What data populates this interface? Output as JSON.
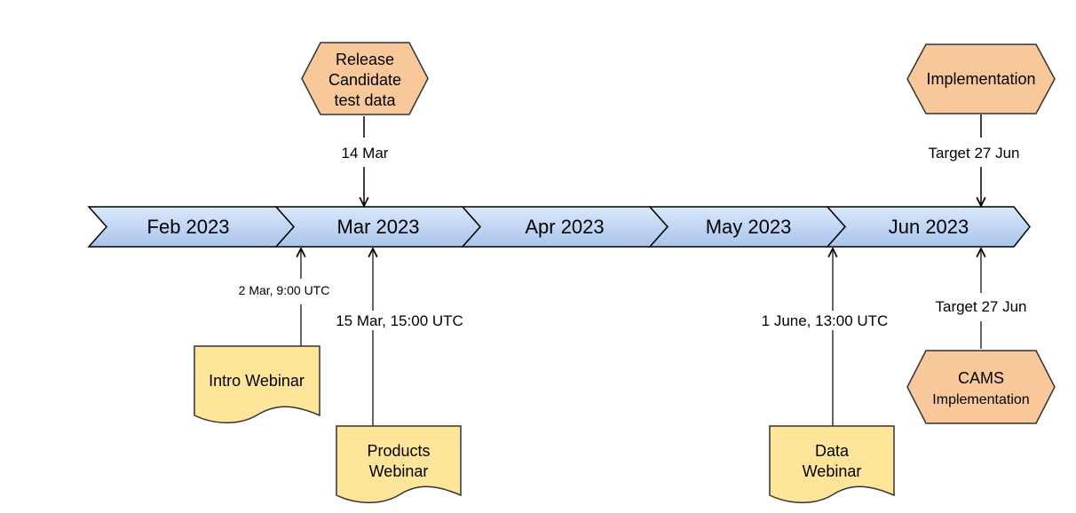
{
  "months": [
    "Feb 2023",
    "Mar 2023",
    "Apr 2023",
    "May 2023",
    "Jun 2023"
  ],
  "milestones_above": [
    {
      "lines": [
        "Release",
        "Candidate",
        "test data"
      ],
      "date_label": "14 Mar"
    },
    {
      "lines": [
        "Implementation"
      ],
      "date_label": "Target 27 Jun"
    }
  ],
  "events_below": [
    {
      "lines": [
        "Intro Webinar"
      ],
      "date_label": "2 Mar, 9:00 UTC"
    },
    {
      "lines": [
        "Products",
        "Webinar"
      ],
      "date_label": "15 Mar, 15:00 UTC"
    },
    {
      "lines": [
        "Data",
        "Webinar"
      ],
      "date_label": "1 June, 13:00 UTC"
    },
    {
      "lines": [
        "CAMS",
        "Implementation"
      ],
      "date_label": "Target 27 Jun"
    }
  ],
  "colors": {
    "chevron_top": "#dae8fc",
    "chevron_bottom": "#a9c4eb",
    "hexagon_fill": "#f8c89a",
    "document_fill": "#ffe599",
    "stroke": "#333333"
  }
}
